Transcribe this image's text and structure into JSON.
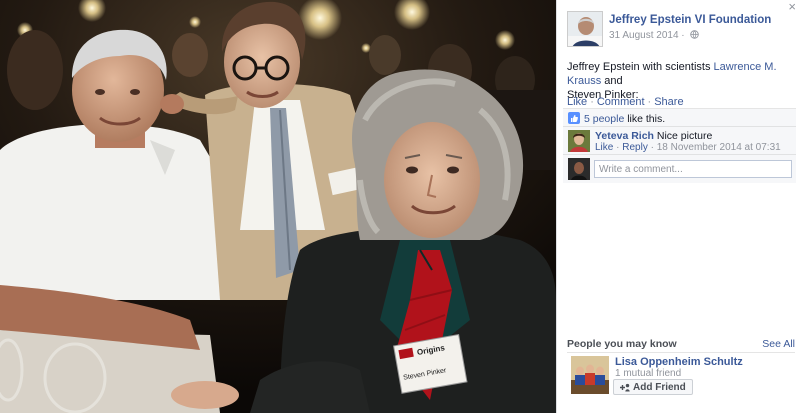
{
  "viewer": {
    "close_glyph": "×",
    "badge_text": "Origins",
    "badge_name": "Steven Pinker"
  },
  "post": {
    "page_name": "Jeffrey Epstein VI Foundation",
    "date": "31 August 2014 ·",
    "caption_prefix": "Jeffrey Epstein with scientists ",
    "caption_link_1": "Lawrence M. Krauss",
    "caption_middle": " and ",
    "caption_name_2": "Steven Pinker:",
    "privacy_icon": "globe-icon"
  },
  "actions": {
    "like": "Like",
    "comment": "Comment",
    "share": "Share",
    "separator": "·"
  },
  "likes": {
    "count_text": "5 people",
    "suffix": " like this.",
    "icon": "thumbs-up-icon"
  },
  "comment": {
    "author": "Yeteva Rich",
    "text": " Nice picture",
    "like": "Like",
    "reply": "Reply",
    "separator": " · ",
    "timestamp": "18 November 2014 at 07:31"
  },
  "reply_box": {
    "placeholder": "Write a comment..."
  },
  "pymk": {
    "title": "People you may know",
    "see_all": "See All",
    "person": {
      "name": "Lisa Oppenheim Schultz",
      "mutual": "1 mutual friend",
      "add_label": "Add Friend"
    }
  },
  "colors": {
    "link": "#3b5998",
    "muted": "#90949c",
    "tie": "#b1121b"
  }
}
